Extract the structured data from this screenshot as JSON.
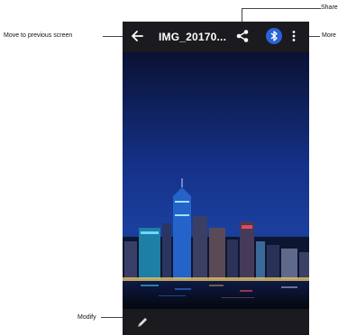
{
  "app": {
    "title": "IMG_20170...",
    "actions": {
      "back": "back-arrow-icon",
      "share": "share-icon",
      "bluetooth": "bluetooth-icon",
      "more": "more-vert-icon",
      "modify": "edit-pencil-icon"
    }
  },
  "callouts": {
    "previous": "Move to previous screen",
    "share": "Share",
    "more": "More",
    "modify": "Modify"
  },
  "colors": {
    "bar": "#1a1a1f",
    "bluetooth": "#2a62d6"
  }
}
